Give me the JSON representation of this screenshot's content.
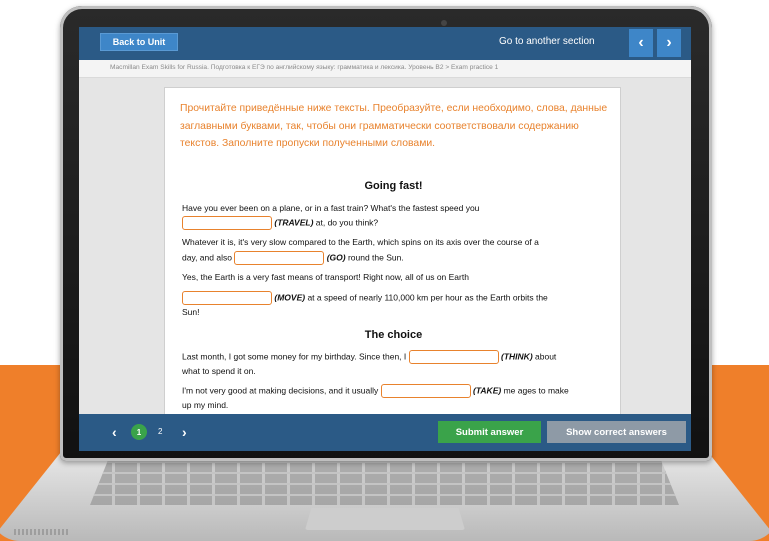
{
  "topbar": {
    "back_label": "Back to Unit",
    "goto_label": "Go to another section",
    "prev_icon": "‹",
    "next_icon": "›"
  },
  "breadcrumb": "Macmillan Exam Skills for Russia. Подготовка к ЕГЭ по английскому языку: грамматика и лексика. Уровень B2 > Exam practice 1",
  "instructions": "Прочитайте приведённые ниже тексты. Преобразуйте, если необходимо, слова, данные заглавными буквами, так, чтобы они грамматически соответствовали содержанию текстов. Заполните пропуски полученными словами.",
  "sections": [
    {
      "title": "Going fast!",
      "lines": [
        "Have you ever been on a plane, or in a fast train? What's the fastest speed you",
        "(TRAVEL)",
        " at, do you think?",
        "Whatever it is, it's very slow compared to the Earth, which spins on its axis over the course of a",
        "day, and also",
        "(GO)",
        " round the Sun.",
        "Yes, the Earth is a very fast means of transport! Right now, all of us on Earth",
        "(MOVE)",
        " at a speed of nearly 110,000 km per hour as the Earth orbits the",
        "Sun!"
      ]
    },
    {
      "title": "The choice",
      "lines": [
        "Last month, I got some money for my birthday. Since then, I",
        "(THINK)",
        " about",
        "what to spend it on.",
        "I'm not very good at making decisions, and it usually",
        "(TAKE)",
        " me ages to make",
        "up my mind."
      ]
    }
  ],
  "footer": {
    "prev_icon": "‹",
    "next_icon": "›",
    "pages": [
      "1",
      "2"
    ],
    "active_page": "1",
    "submit_label": "Submit answer",
    "show_label": "Show correct answers"
  },
  "colors": {
    "accent_orange": "#e8822d",
    "bar_blue": "#2b5a86",
    "button_blue": "#3e86c8",
    "submit_green": "#3aa34a",
    "show_grey": "#8e9aa6",
    "background_orange": "#ef7f2a"
  }
}
